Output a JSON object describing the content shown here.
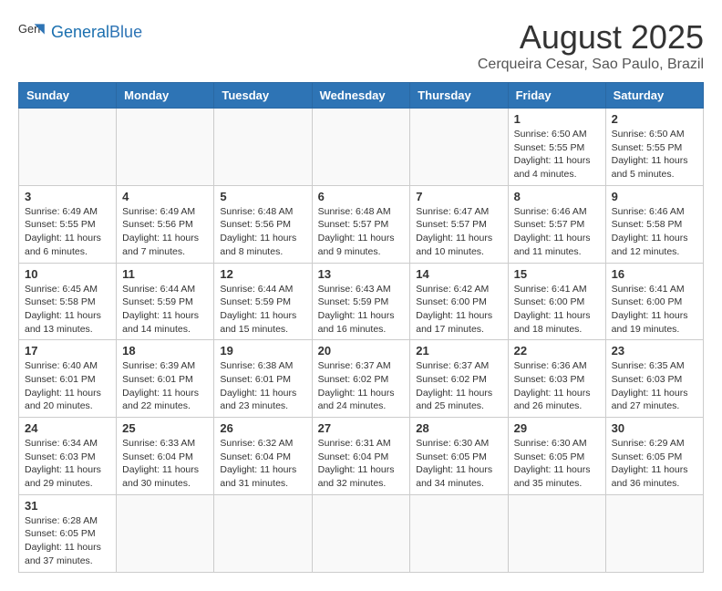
{
  "header": {
    "logo_general": "General",
    "logo_blue": "Blue",
    "month_title": "August 2025",
    "location": "Cerqueira Cesar, Sao Paulo, Brazil"
  },
  "weekdays": [
    "Sunday",
    "Monday",
    "Tuesday",
    "Wednesday",
    "Thursday",
    "Friday",
    "Saturday"
  ],
  "weeks": [
    [
      {
        "day": "",
        "info": ""
      },
      {
        "day": "",
        "info": ""
      },
      {
        "day": "",
        "info": ""
      },
      {
        "day": "",
        "info": ""
      },
      {
        "day": "",
        "info": ""
      },
      {
        "day": "1",
        "info": "Sunrise: 6:50 AM\nSunset: 5:55 PM\nDaylight: 11 hours and 4 minutes."
      },
      {
        "day": "2",
        "info": "Sunrise: 6:50 AM\nSunset: 5:55 PM\nDaylight: 11 hours and 5 minutes."
      }
    ],
    [
      {
        "day": "3",
        "info": "Sunrise: 6:49 AM\nSunset: 5:55 PM\nDaylight: 11 hours and 6 minutes."
      },
      {
        "day": "4",
        "info": "Sunrise: 6:49 AM\nSunset: 5:56 PM\nDaylight: 11 hours and 7 minutes."
      },
      {
        "day": "5",
        "info": "Sunrise: 6:48 AM\nSunset: 5:56 PM\nDaylight: 11 hours and 8 minutes."
      },
      {
        "day": "6",
        "info": "Sunrise: 6:48 AM\nSunset: 5:57 PM\nDaylight: 11 hours and 9 minutes."
      },
      {
        "day": "7",
        "info": "Sunrise: 6:47 AM\nSunset: 5:57 PM\nDaylight: 11 hours and 10 minutes."
      },
      {
        "day": "8",
        "info": "Sunrise: 6:46 AM\nSunset: 5:57 PM\nDaylight: 11 hours and 11 minutes."
      },
      {
        "day": "9",
        "info": "Sunrise: 6:46 AM\nSunset: 5:58 PM\nDaylight: 11 hours and 12 minutes."
      }
    ],
    [
      {
        "day": "10",
        "info": "Sunrise: 6:45 AM\nSunset: 5:58 PM\nDaylight: 11 hours and 13 minutes."
      },
      {
        "day": "11",
        "info": "Sunrise: 6:44 AM\nSunset: 5:59 PM\nDaylight: 11 hours and 14 minutes."
      },
      {
        "day": "12",
        "info": "Sunrise: 6:44 AM\nSunset: 5:59 PM\nDaylight: 11 hours and 15 minutes."
      },
      {
        "day": "13",
        "info": "Sunrise: 6:43 AM\nSunset: 5:59 PM\nDaylight: 11 hours and 16 minutes."
      },
      {
        "day": "14",
        "info": "Sunrise: 6:42 AM\nSunset: 6:00 PM\nDaylight: 11 hours and 17 minutes."
      },
      {
        "day": "15",
        "info": "Sunrise: 6:41 AM\nSunset: 6:00 PM\nDaylight: 11 hours and 18 minutes."
      },
      {
        "day": "16",
        "info": "Sunrise: 6:41 AM\nSunset: 6:00 PM\nDaylight: 11 hours and 19 minutes."
      }
    ],
    [
      {
        "day": "17",
        "info": "Sunrise: 6:40 AM\nSunset: 6:01 PM\nDaylight: 11 hours and 20 minutes."
      },
      {
        "day": "18",
        "info": "Sunrise: 6:39 AM\nSunset: 6:01 PM\nDaylight: 11 hours and 22 minutes."
      },
      {
        "day": "19",
        "info": "Sunrise: 6:38 AM\nSunset: 6:01 PM\nDaylight: 11 hours and 23 minutes."
      },
      {
        "day": "20",
        "info": "Sunrise: 6:37 AM\nSunset: 6:02 PM\nDaylight: 11 hours and 24 minutes."
      },
      {
        "day": "21",
        "info": "Sunrise: 6:37 AM\nSunset: 6:02 PM\nDaylight: 11 hours and 25 minutes."
      },
      {
        "day": "22",
        "info": "Sunrise: 6:36 AM\nSunset: 6:03 PM\nDaylight: 11 hours and 26 minutes."
      },
      {
        "day": "23",
        "info": "Sunrise: 6:35 AM\nSunset: 6:03 PM\nDaylight: 11 hours and 27 minutes."
      }
    ],
    [
      {
        "day": "24",
        "info": "Sunrise: 6:34 AM\nSunset: 6:03 PM\nDaylight: 11 hours and 29 minutes."
      },
      {
        "day": "25",
        "info": "Sunrise: 6:33 AM\nSunset: 6:04 PM\nDaylight: 11 hours and 30 minutes."
      },
      {
        "day": "26",
        "info": "Sunrise: 6:32 AM\nSunset: 6:04 PM\nDaylight: 11 hours and 31 minutes."
      },
      {
        "day": "27",
        "info": "Sunrise: 6:31 AM\nSunset: 6:04 PM\nDaylight: 11 hours and 32 minutes."
      },
      {
        "day": "28",
        "info": "Sunrise: 6:30 AM\nSunset: 6:05 PM\nDaylight: 11 hours and 34 minutes."
      },
      {
        "day": "29",
        "info": "Sunrise: 6:30 AM\nSunset: 6:05 PM\nDaylight: 11 hours and 35 minutes."
      },
      {
        "day": "30",
        "info": "Sunrise: 6:29 AM\nSunset: 6:05 PM\nDaylight: 11 hours and 36 minutes."
      }
    ],
    [
      {
        "day": "31",
        "info": "Sunrise: 6:28 AM\nSunset: 6:05 PM\nDaylight: 11 hours and 37 minutes."
      },
      {
        "day": "",
        "info": ""
      },
      {
        "day": "",
        "info": ""
      },
      {
        "day": "",
        "info": ""
      },
      {
        "day": "",
        "info": ""
      },
      {
        "day": "",
        "info": ""
      },
      {
        "day": "",
        "info": ""
      }
    ]
  ]
}
